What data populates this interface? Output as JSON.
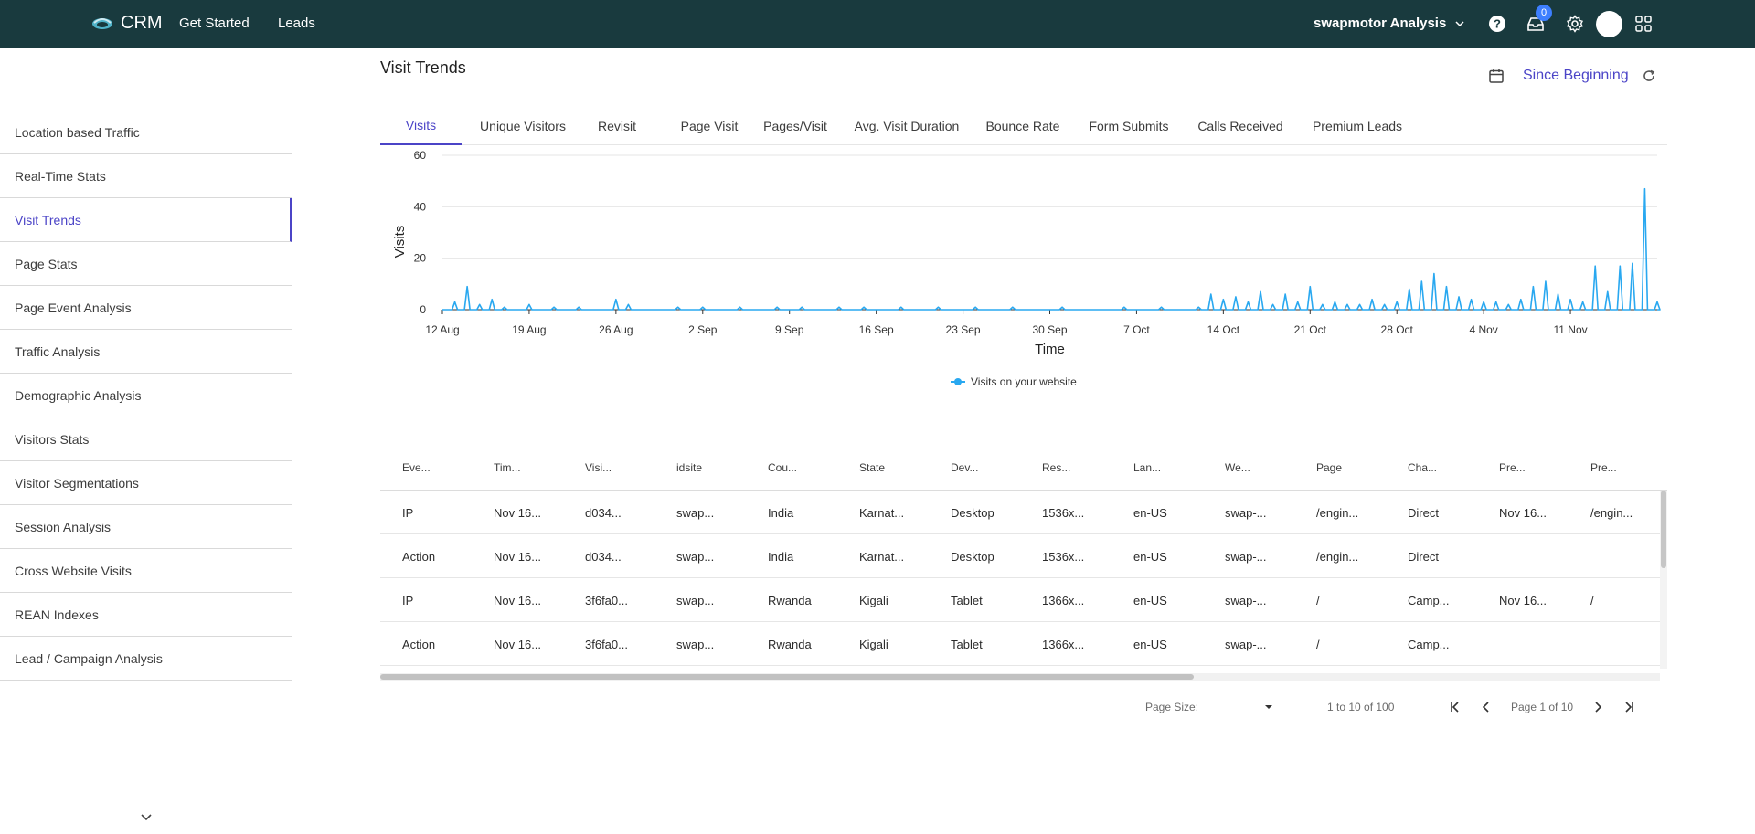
{
  "header": {
    "app_name": "CRM",
    "nav": [
      "Get Started",
      "Leads"
    ],
    "account": "swapmotor Analysis",
    "notifications_count": "0",
    "icons": [
      "help-icon",
      "inbox-icon",
      "settings-icon",
      "avatar",
      "apps-grid-icon"
    ]
  },
  "sidebar": {
    "items": [
      {
        "label": "Location based Traffic"
      },
      {
        "label": "Real-Time Stats"
      },
      {
        "label": "Visit Trends",
        "active": true
      },
      {
        "label": "Page Stats"
      },
      {
        "label": "Page Event Analysis"
      },
      {
        "label": "Traffic Analysis"
      },
      {
        "label": "Demographic Analysis"
      },
      {
        "label": "Visitors Stats"
      },
      {
        "label": "Visitor Segmentations"
      },
      {
        "label": "Session Analysis"
      },
      {
        "label": "Cross Website Visits"
      },
      {
        "label": "REAN Indexes"
      },
      {
        "label": "Lead / Campaign Analysis"
      }
    ]
  },
  "main": {
    "title": "Visit Trends",
    "date_range": "Since Beginning",
    "tabs": [
      "Visits",
      "Unique Visitors",
      "Revisit",
      "Page Visit",
      "Pages/Visit",
      "Avg. Visit Duration",
      "Bounce Rate",
      "Form Submits",
      "Calls Received",
      "Premium Leads"
    ],
    "active_tab": "Visits"
  },
  "chart_data": {
    "type": "line",
    "xlabel": "Time",
    "ylabel": "Visits",
    "ylim": [
      0,
      60
    ],
    "yticks": [
      "0",
      "20",
      "40",
      "60"
    ],
    "xticks": [
      "12 Aug",
      "19 Aug",
      "26 Aug",
      "2 Sep",
      "9 Sep",
      "16 Sep",
      "23 Sep",
      "30 Sep",
      "7 Oct",
      "14 Oct",
      "21 Oct",
      "28 Oct",
      "4 Nov",
      "11 Nov"
    ],
    "x_start": "2024-08-12",
    "x_end": "2024-11-18",
    "grid": true,
    "color": "#29a8f0",
    "legend": "bottom-center",
    "series": [
      {
        "name": "Visits on your website",
        "points": [
          [
            "2024-08-13",
            3
          ],
          [
            "2024-08-14",
            9
          ],
          [
            "2024-08-15",
            2
          ],
          [
            "2024-08-16",
            4
          ],
          [
            "2024-08-17",
            1
          ],
          [
            "2024-08-19",
            2
          ],
          [
            "2024-08-21",
            1
          ],
          [
            "2024-08-23",
            1
          ],
          [
            "2024-08-26",
            4
          ],
          [
            "2024-08-27",
            2
          ],
          [
            "2024-08-31",
            1
          ],
          [
            "2024-09-02",
            1
          ],
          [
            "2024-09-05",
            1
          ],
          [
            "2024-09-08",
            1
          ],
          [
            "2024-09-10",
            1
          ],
          [
            "2024-09-13",
            1
          ],
          [
            "2024-09-15",
            1
          ],
          [
            "2024-09-18",
            1
          ],
          [
            "2024-09-21",
            1
          ],
          [
            "2024-09-24",
            1
          ],
          [
            "2024-09-27",
            1
          ],
          [
            "2024-10-01",
            1
          ],
          [
            "2024-10-06",
            1
          ],
          [
            "2024-10-09",
            1
          ],
          [
            "2024-10-12",
            1
          ],
          [
            "2024-10-13",
            6
          ],
          [
            "2024-10-14",
            4
          ],
          [
            "2024-10-15",
            5
          ],
          [
            "2024-10-16",
            3
          ],
          [
            "2024-10-17",
            7
          ],
          [
            "2024-10-18",
            2
          ],
          [
            "2024-10-19",
            6
          ],
          [
            "2024-10-20",
            3
          ],
          [
            "2024-10-21",
            9
          ],
          [
            "2024-10-22",
            2
          ],
          [
            "2024-10-23",
            3
          ],
          [
            "2024-10-24",
            2
          ],
          [
            "2024-10-25",
            2
          ],
          [
            "2024-10-26",
            4
          ],
          [
            "2024-10-27",
            2
          ],
          [
            "2024-10-28",
            3
          ],
          [
            "2024-10-29",
            8
          ],
          [
            "2024-10-30",
            11
          ],
          [
            "2024-10-31",
            14
          ],
          [
            "2024-11-01",
            9
          ],
          [
            "2024-11-02",
            5
          ],
          [
            "2024-11-03",
            4
          ],
          [
            "2024-11-04",
            3
          ],
          [
            "2024-11-05",
            3
          ],
          [
            "2024-11-06",
            2
          ],
          [
            "2024-11-07",
            4
          ],
          [
            "2024-11-08",
            9
          ],
          [
            "2024-11-09",
            11
          ],
          [
            "2024-11-10",
            6
          ],
          [
            "2024-11-11",
            4
          ],
          [
            "2024-11-12",
            3
          ],
          [
            "2024-11-13",
            17
          ],
          [
            "2024-11-14",
            7
          ],
          [
            "2024-11-15",
            17
          ],
          [
            "2024-11-16",
            18
          ],
          [
            "2024-11-17",
            47
          ],
          [
            "2024-11-18",
            3
          ]
        ]
      }
    ]
  },
  "table": {
    "columns": [
      "Eve...",
      "Tim...",
      "Visi...",
      "idsite",
      "Cou...",
      "State",
      "Dev...",
      "Res...",
      "Lan...",
      "We...",
      "Page",
      "Cha...",
      "Pre...",
      "Pre..."
    ],
    "rows": [
      [
        "IP",
        "Nov 16...",
        "d034...",
        "swap...",
        "India",
        "Karnat...",
        "Desktop",
        "1536x...",
        "en-US",
        "swap-...",
        "/engin...",
        "Direct",
        "Nov 16...",
        "/engin..."
      ],
      [
        "Action",
        "Nov 16...",
        "d034...",
        "swap...",
        "India",
        "Karnat...",
        "Desktop",
        "1536x...",
        "en-US",
        "swap-...",
        "/engin...",
        "Direct",
        "",
        ""
      ],
      [
        "IP",
        "Nov 16...",
        "3f6fa0...",
        "swap...",
        "Rwanda",
        "Kigali",
        "Tablet",
        "1366x...",
        "en-US",
        "swap-...",
        "/",
        "Camp...",
        "Nov 16...",
        "/"
      ],
      [
        "Action",
        "Nov 16...",
        "3f6fa0...",
        "swap...",
        "Rwanda",
        "Kigali",
        "Tablet",
        "1366x...",
        "en-US",
        "swap-...",
        "/",
        "Camp...",
        "",
        ""
      ]
    ]
  },
  "pagination": {
    "page_size_label": "Page Size:",
    "range": "1 to 10 of 100",
    "page": "Page 1 of 10"
  }
}
